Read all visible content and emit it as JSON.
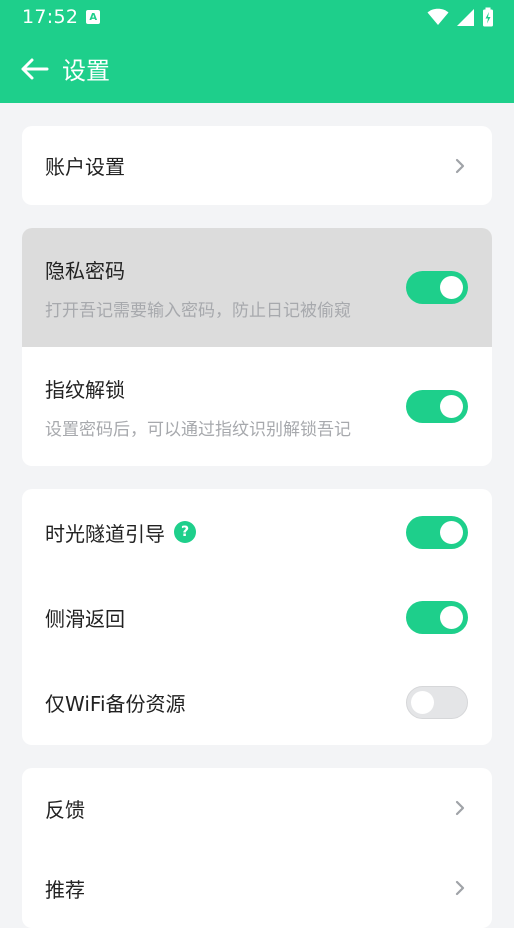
{
  "status_bar": {
    "time": "17:52",
    "notification_icon": "A"
  },
  "header": {
    "title": "设置"
  },
  "colors": {
    "accent": "#1ecf8b",
    "background": "#f3f4f6",
    "pressed_row": "#dcdcdc"
  },
  "account": {
    "label": "账户设置"
  },
  "privacy": {
    "password": {
      "title": "隐私密码",
      "subtitle": "打开吾记需要输入密码，防止日记被偷窥",
      "enabled": true
    },
    "fingerprint": {
      "title": "指纹解锁",
      "subtitle": "设置密码后，可以通过指纹识别解锁吾记",
      "enabled": true
    }
  },
  "options": {
    "time_tunnel": {
      "title": "时光隧道引导",
      "help": "?",
      "enabled": true
    },
    "swipe_back": {
      "title": "侧滑返回",
      "enabled": true
    },
    "wifi_backup": {
      "title": "仅WiFi备份资源",
      "enabled": false
    }
  },
  "more": {
    "feedback": {
      "label": "反馈"
    },
    "recommend": {
      "label": "推荐"
    }
  }
}
